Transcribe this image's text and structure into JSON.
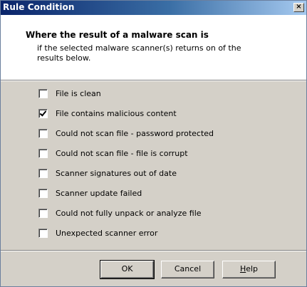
{
  "window": {
    "title": "Rule Condition",
    "close_glyph": "×"
  },
  "header": {
    "title": "Where the result of a malware scan is",
    "description": "if the selected malware scanner(s) returns on of the results below."
  },
  "options": [
    {
      "label": "File is clean",
      "checked": false
    },
    {
      "label": "File contains malicious content",
      "checked": true
    },
    {
      "label": "Could not scan file - password protected",
      "checked": false
    },
    {
      "label": "Could not scan file - file is corrupt",
      "checked": false
    },
    {
      "label": "Scanner signatures out of date",
      "checked": false
    },
    {
      "label": "Scanner update failed",
      "checked": false
    },
    {
      "label": "Could not fully unpack or analyze file",
      "checked": false
    },
    {
      "label": "Unexpected scanner error",
      "checked": false
    }
  ],
  "buttons": {
    "ok": "OK",
    "cancel": "Cancel",
    "help_first": "H",
    "help_rest": "elp"
  }
}
